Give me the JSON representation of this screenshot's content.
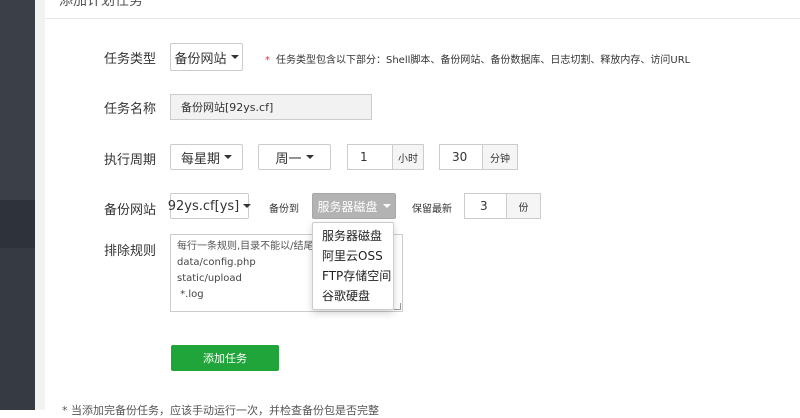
{
  "header": {
    "title": "添加计划任务"
  },
  "form": {
    "task_type": {
      "label": "任务类型",
      "value": "备份网站",
      "hint_star": "*",
      "hint": "任务类型包含以下部分：Shell脚本、备份网站、备份数据库、日志切割、释放内存、访问URL"
    },
    "task_name": {
      "label": "任务名称",
      "value": "备份网站[92ys.cf]"
    },
    "period": {
      "label": "执行周期",
      "frequency": "每星期",
      "weekday": "周一",
      "hour_value": "1",
      "hour_unit": "小时",
      "minute_value": "30",
      "minute_unit": "分钟"
    },
    "backup_site": {
      "label": "备份网站",
      "site": "92ys.cf[ys]",
      "backup_to_label": "备份到",
      "destination": "服务器磁盘",
      "keep_label": "保留最新",
      "keep_value": "3",
      "keep_unit": "份"
    },
    "exclude": {
      "label": "排除规则",
      "placeholder": "每行一条规则,目录不能以/结尾，示例：",
      "lines": [
        "data/config.php",
        "static/upload",
        " *.log"
      ]
    },
    "destination_options": [
      "服务器磁盘",
      "阿里云OSS",
      "FTP存储空间",
      "谷歌硬盘"
    ],
    "submit_label": "添加任务",
    "footer_note": "* 当添加完备份任务，应该手动运行一次，并检查备份包是否完整"
  },
  "colors": {
    "primary": "#20a53a",
    "sidebar": "#3a3f48",
    "required_star": "#e33333"
  }
}
